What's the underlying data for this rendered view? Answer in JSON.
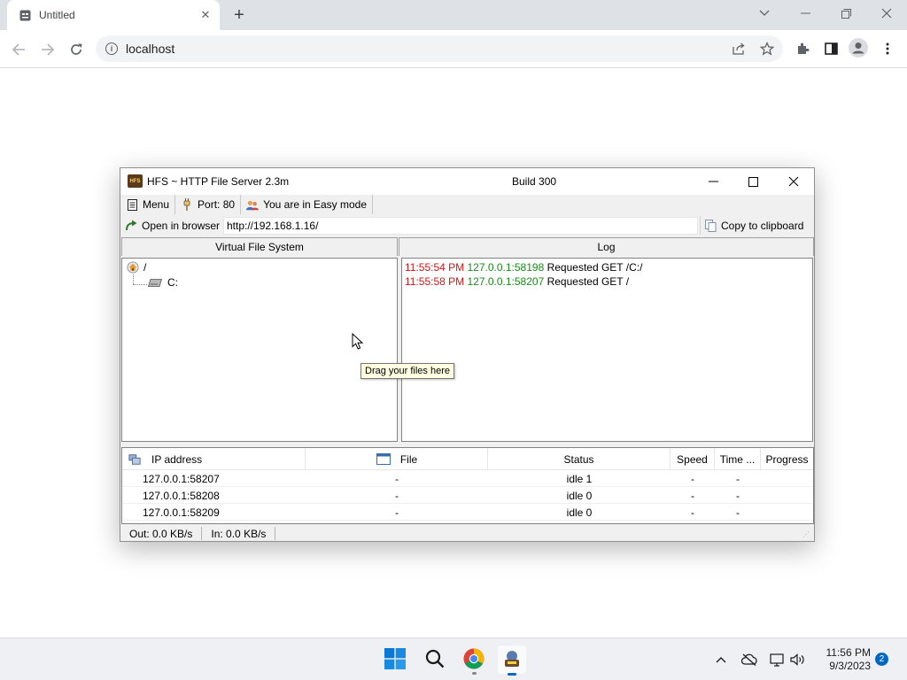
{
  "browser": {
    "tab_title": "Untitled",
    "url": "localhost"
  },
  "hfs": {
    "title": "HFS ~ HTTP File Server 2.3m",
    "build": "Build 300",
    "menu": {
      "menu_label": "Menu",
      "port_label": "Port: 80",
      "mode_label": "You are in Easy mode"
    },
    "open_in_browser": "Open in browser",
    "server_url": "http://192.168.1.16/",
    "copy_to_clipboard": "Copy to clipboard",
    "vfs_header": "Virtual File System",
    "log_header": "Log",
    "vfs_tree": {
      "root": "/",
      "drive": "C:"
    },
    "log": [
      {
        "time": "11:55:54 PM",
        "ip": "127.0.0.1:58198",
        "message": "Requested GET /C:/"
      },
      {
        "time": "11:55:58 PM",
        "ip": "127.0.0.1:58207",
        "message": "Requested GET /"
      }
    ],
    "tooltip": "Drag your files here",
    "connections": {
      "columns": {
        "ip": "IP address",
        "file": "File",
        "status": "Status",
        "speed": "Speed",
        "time": "Time ...",
        "progress": "Progress"
      },
      "rows": [
        {
          "ip": "127.0.0.1:58207",
          "file": "-",
          "status": "idle 1",
          "speed": "-",
          "time": "-",
          "progress": ""
        },
        {
          "ip": "127.0.0.1:58208",
          "file": "-",
          "status": "idle 0",
          "speed": "-",
          "time": "-",
          "progress": ""
        },
        {
          "ip": "127.0.0.1:58209",
          "file": "-",
          "status": "idle 0",
          "speed": "-",
          "time": "-",
          "progress": ""
        }
      ]
    },
    "status": {
      "out": "Out: 0.0 KB/s",
      "in": "In: 0.0 KB/s"
    }
  },
  "taskbar": {
    "time": "11:56 PM",
    "date": "9/3/2023",
    "notification_count": "2"
  },
  "colors": {
    "log_time": "#c41a1a",
    "log_ip": "#1a8a1a",
    "taskbar_accent": "#0067c0",
    "tooltip_bg": "#ffffe1"
  }
}
